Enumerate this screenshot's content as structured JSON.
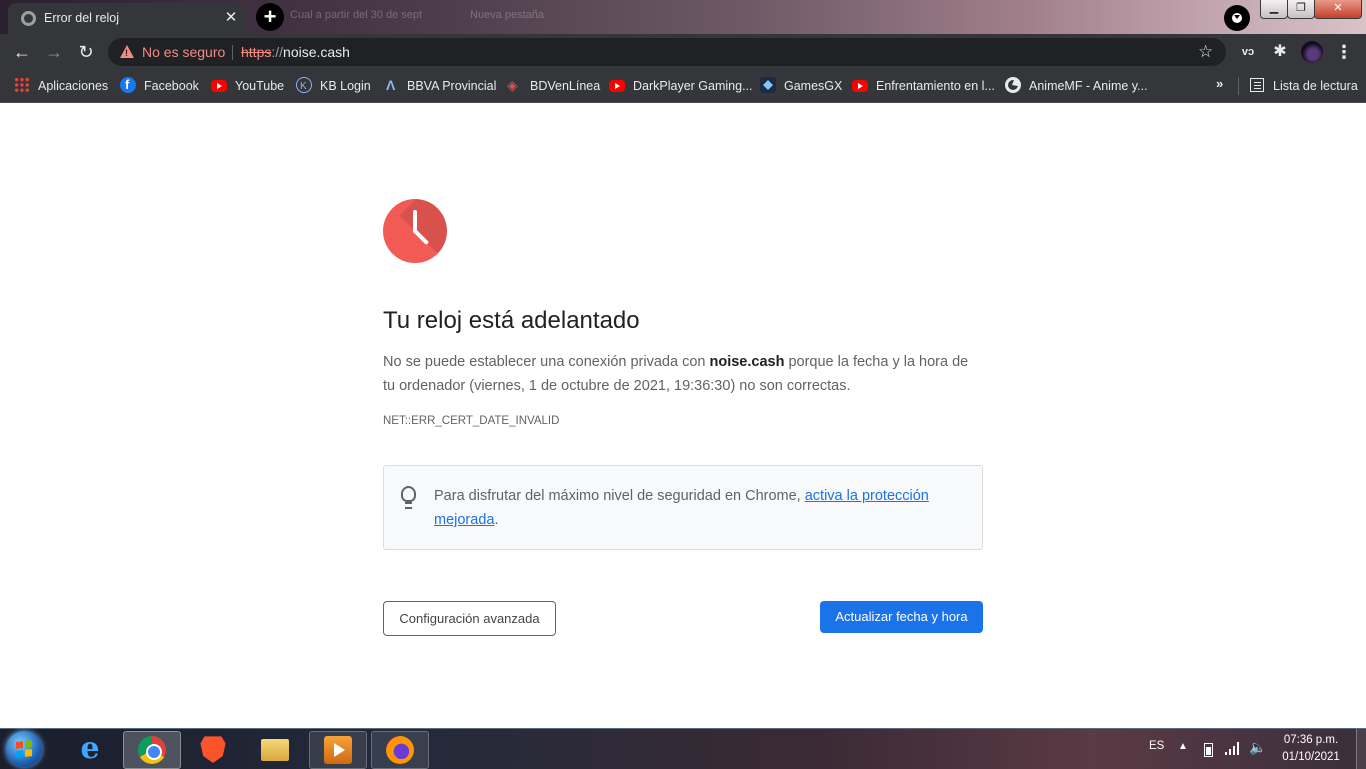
{
  "tabs": {
    "active_title": "Error del reloj",
    "background_titles": [
      "Cual a partir del 30 de sept",
      "Nueva pestaña"
    ]
  },
  "toolbar": {
    "security_label": "No es seguro",
    "url_scheme": "https",
    "url_separator": "://",
    "url_host": "noise.cash",
    "extension_vd": "vↄ"
  },
  "bookmarks": {
    "items": [
      {
        "label": "Aplicaciones",
        "icon": "apps-grid-icon"
      },
      {
        "label": "Facebook",
        "icon": "facebook-icon"
      },
      {
        "label": "YouTube",
        "icon": "youtube-icon"
      },
      {
        "label": "KB Login",
        "icon": "kb-icon"
      },
      {
        "label": "BBVA Provincial",
        "icon": "bbva-icon"
      },
      {
        "label": "BDVenLínea",
        "icon": "bdv-icon"
      },
      {
        "label": "DarkPlayer Gaming...",
        "icon": "youtube-icon"
      },
      {
        "label": "GamesGX",
        "icon": "gamesgx-icon"
      },
      {
        "label": "Enfrentamiento en l...",
        "icon": "youtube-icon"
      },
      {
        "label": "AnimeMF - Anime y...",
        "icon": "globe-icon"
      }
    ],
    "overflow": "»",
    "reading_list": "Lista de lectura"
  },
  "page": {
    "heading": "Tu reloj está adelantado",
    "desc_pre": "No se puede establecer una conexión privada con ",
    "desc_host": "noise.cash",
    "desc_post": " porque la fecha y la hora de tu ordenador (viernes, 1 de octubre de 2021, 19:36:30) no son correctas.",
    "error_code": "NET::ERR_CERT_DATE_INVALID",
    "tip_pre": "Para disfrutar del máximo nivel de seguridad en Chrome, ",
    "tip_link": "activa la protección mejorada",
    "tip_post": ".",
    "advanced_button": "Configuración avanzada",
    "update_button": "Actualizar fecha y hora",
    "accent_color": "#1a73e8",
    "clock_icon_color": "#f25b55"
  },
  "taskbar": {
    "apps": [
      "internet-explorer",
      "chrome",
      "brave",
      "file-explorer",
      "media-player",
      "firefox"
    ],
    "language": "ES",
    "time": "07:36 p.m.",
    "date": "01/10/2021"
  }
}
